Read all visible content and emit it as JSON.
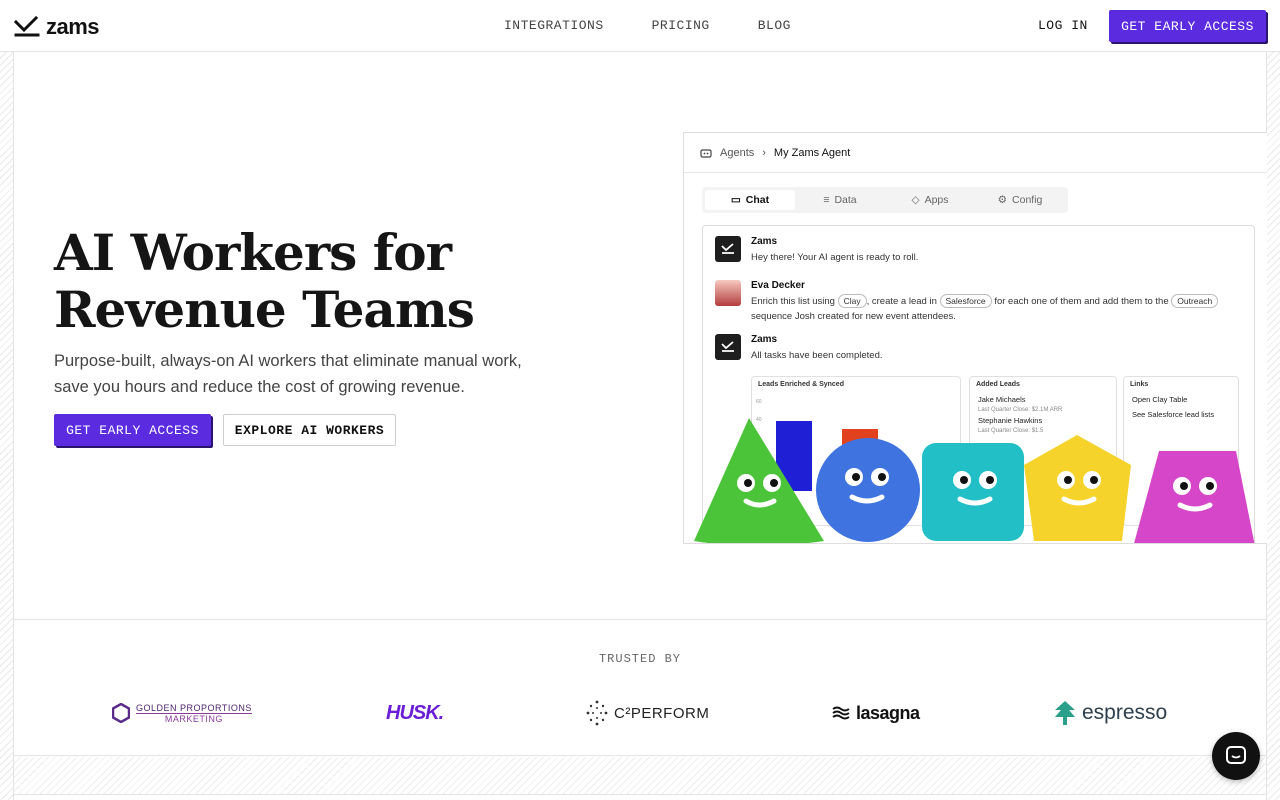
{
  "header": {
    "brand": "zams",
    "nav": [
      "INTEGRATIONS",
      "PRICING",
      "BLOG"
    ],
    "login": "LOG IN",
    "cta": "GET EARLY ACCESS"
  },
  "hero": {
    "title": "AI Workers for Revenue Teams",
    "subtitle": "Purpose-built, always-on AI workers that eliminate manual work, save you hours and reduce the cost of growing revenue.",
    "primary_button": "GET EARLY ACCESS",
    "secondary_button": "EXPLORE AI WORKERS"
  },
  "mockup": {
    "breadcrumb": [
      "Agents",
      "My Zams Agent"
    ],
    "tabs": [
      "Chat",
      "Data",
      "Apps",
      "Config"
    ],
    "messages": [
      {
        "name": "Zams",
        "text": "Hey there! Your AI agent is ready to roll."
      },
      {
        "name": "Eva Decker",
        "text_parts": [
          "Enrich this list using",
          "Clay",
          ", create a lead in",
          "Salesforce",
          "for each one of them and add them to the",
          "Outreach",
          "sequence Josh created for new event attendees."
        ]
      },
      {
        "name": "Zams",
        "text": "All tasks have been completed."
      }
    ],
    "panels": {
      "leads_title": "Leads Enriched & Synced",
      "chart_ticks": [
        "60",
        "40"
      ],
      "added_title": "Added Leads",
      "added": [
        {
          "name": "Jake Michaels",
          "detail": "Last Quarter Close: $2.1M ARR"
        },
        {
          "name": "Stephanie Hawkins",
          "detail": "Last Quarter Close: $1.5"
        }
      ],
      "links_title": "Links",
      "links": [
        "Open Clay Table",
        "See Salesforce lead lists"
      ]
    }
  },
  "trusted": {
    "label": "TRUSTED BY",
    "brands": {
      "golden_top": "GOLDEN PROPORTIONS",
      "golden_bottom": "MARKETING",
      "husk": "HUSK.",
      "c2": "C²PERFORM",
      "lasagna": "lasagna",
      "espresso": "espresso"
    }
  },
  "colors": {
    "accent": "#5b2be0",
    "text": "#151515"
  }
}
